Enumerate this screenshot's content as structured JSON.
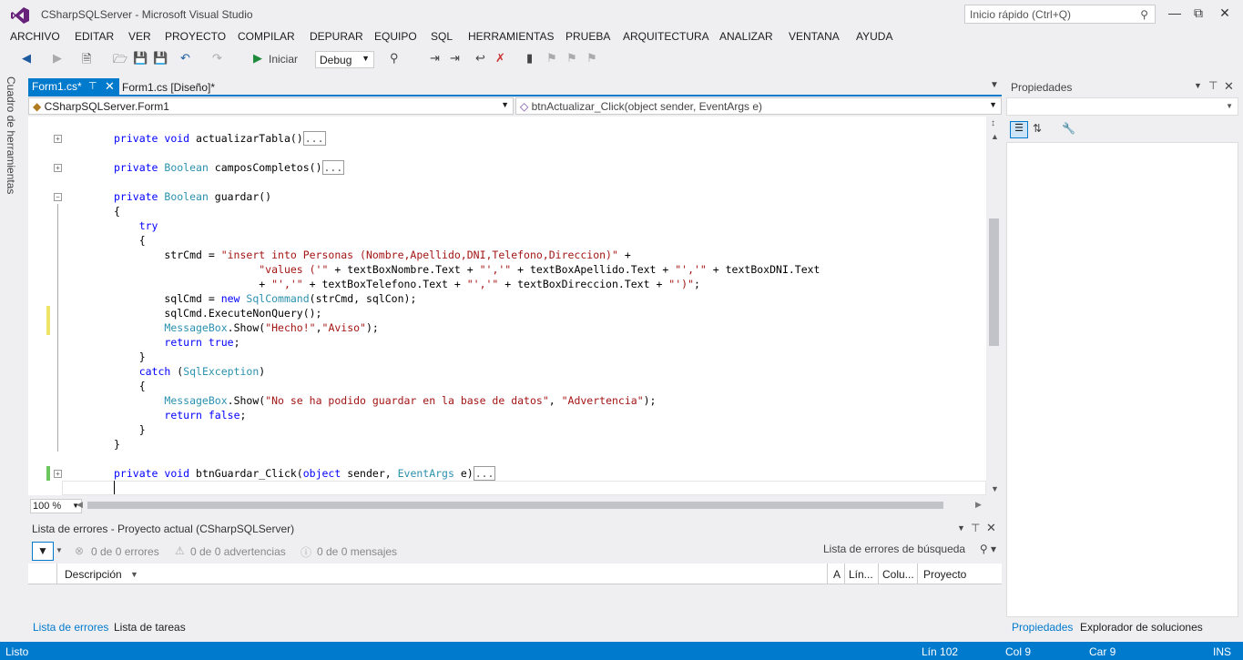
{
  "window": {
    "title": "CSharpSQLServer - Microsoft Visual Studio",
    "quick_launch_placeholder": "Inicio rápido (Ctrl+Q)"
  },
  "menu": [
    "ARCHIVO",
    "EDITAR",
    "VER",
    "PROYECTO",
    "COMPILAR",
    "DEPURAR",
    "EQUIPO",
    "SQL",
    "HERRAMIENTAS",
    "PRUEBA",
    "ARQUITECTURA",
    "ANALIZAR",
    "VENTANA",
    "AYUDA"
  ],
  "toolbar": {
    "start_label": "Iniciar",
    "config": "Debug"
  },
  "left_tab": "Cuadro de herramientas",
  "tabs": {
    "active": "Form1.cs*",
    "second": "Form1.cs [Diseño]*"
  },
  "nav": {
    "class": "CSharpSQLServer.Form1",
    "member": "btnActualizar_Click(object sender, EventArgs e)"
  },
  "zoom": "100 %",
  "properties": {
    "title": "Propiedades"
  },
  "errors": {
    "title": "Lista de errores - Proyecto actual (CSharpSQLServer)",
    "errors": "0 de 0 errores",
    "warnings": "0 de 0 advertencias",
    "messages": "0 de 0 mensajes",
    "search": "Lista de errores de búsqueda",
    "columns": {
      "desc": "Descripción",
      "a": "A",
      "line": "Lín...",
      "col": "Colu...",
      "proj": "Proyecto"
    }
  },
  "bottom_tabs": {
    "errors": "Lista de errores",
    "tasks": "Lista de tareas",
    "props": "Propiedades",
    "solution": "Explorador de soluciones"
  },
  "status": {
    "ready": "Listo",
    "line": "Lín 102",
    "col": "Col 9",
    "car": "Car 9",
    "ins": "INS"
  },
  "colors": {
    "accent": "#007acc",
    "keyword": "#0000ff",
    "type": "#2b91af",
    "string": "#a31515"
  }
}
